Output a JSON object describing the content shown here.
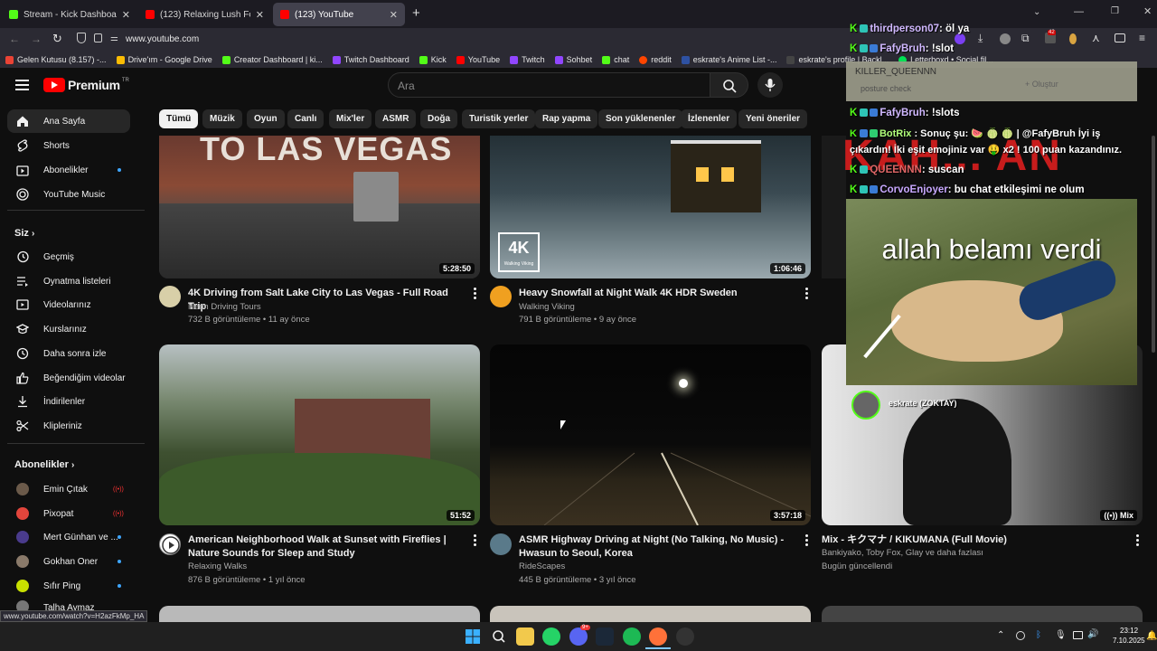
{
  "browser": {
    "tabs": [
      {
        "title": "Stream - Kick Dashboard",
        "color": "#53fc18"
      },
      {
        "title": "(123) Relaxing Lush Forest Thun",
        "color": "#ff0000"
      },
      {
        "title": "(123) YouTube",
        "color": "#ff0000"
      }
    ],
    "url": "www.youtube.com",
    "new_tab": "+",
    "ext_badge": "42",
    "bookmarks": [
      {
        "label": "Gelen Kutusu (8.157) -...",
        "color": "#ea4335"
      },
      {
        "label": "Drive'ım - Google Drive",
        "color": "#fbbc04"
      },
      {
        "label": "Creator Dashboard | ki...",
        "color": "#53fc18"
      },
      {
        "label": "Twitch Dashboard",
        "color": "#9146ff"
      },
      {
        "label": "Kick",
        "color": "#53fc18"
      },
      {
        "label": "YouTube",
        "color": "#ff0000"
      },
      {
        "label": "Twitch",
        "color": "#9146ff"
      },
      {
        "label": "Sohbet",
        "color": "#9146ff"
      },
      {
        "label": "chat",
        "color": "#53fc18"
      },
      {
        "label": "reddit",
        "color": "#ff4500"
      },
      {
        "label": "eskrate's Anime List -...",
        "color": "#2e51a2"
      },
      {
        "label": "eskrate's profile | Backl...",
        "color": "#444444"
      },
      {
        "label": "Letterboxd • Social fil...",
        "color": "#00e054"
      }
    ],
    "status_url": "www.youtube.com/watch?v=H2azFkMp_HA"
  },
  "youtube": {
    "brand": "Premium",
    "region": "TR",
    "search_placeholder": "Ara",
    "chips": [
      "Tümü",
      "Müzik",
      "Oyun",
      "Canlı",
      "Mix'ler",
      "ASMR",
      "Doğa",
      "Turistik yerler",
      "Rap yapma",
      "Son yüklenenler",
      "İzlenenler",
      "Yeni öneriler"
    ],
    "sidebar": {
      "main": [
        "Ana Sayfa",
        "Shorts",
        "Abonelikler",
        "YouTube Music"
      ],
      "you_header": "Siz",
      "you": [
        "Geçmiş",
        "Oynatma listeleri",
        "Videolarınız",
        "Kurslarınız",
        "Daha sonra izle",
        "Beğendiğim videolar",
        "İndirilenler",
        "Klipleriniz"
      ],
      "subs_header": "Abonelikler",
      "subs": [
        "Emin Çıtak",
        "Pixopat",
        "Mert Günhan ve ...",
        "Gokhan Oner",
        "Sıfır Ping",
        "Talha Aymaz"
      ]
    },
    "videos": [
      {
        "title": "4K Driving from Salt Lake City to Las Vegas - Full Road Trip",
        "channel": "Neon Driving Tours",
        "meta": "732 B görüntüleme • 11 ay önce",
        "duration": "5:28:50",
        "overlay": "TO LAS VEGAS"
      },
      {
        "title": "Heavy Snowfall at Night Walk 4K HDR Sweden",
        "channel": "Walking Viking",
        "meta": "791 B görüntüleme • 9 ay önce",
        "duration": "1:06:46",
        "overlay": "4K",
        "overlay_sub": "Walking Viking"
      },
      {
        "title": "American Neighborhood Walk at Sunset with Fireflies | Nature Sounds for Sleep and Study",
        "channel": "Relaxing Walks",
        "meta": "876 B görüntüleme • 1 yıl önce",
        "duration": "51:52"
      },
      {
        "title": "ASMR Highway Driving at Night (No Talking, No Music) - Hwasun to Seoul, Korea",
        "channel": "RideScapes",
        "meta": "445 B görüntüleme • 3 yıl önce",
        "duration": "3:57:18"
      },
      {
        "title": "Mix - キクマナ / KIKUMANA (Full Movie)",
        "channel": "Bankiyako, Toby Fox, Glay ve daha fazlası",
        "meta": "Bugün güncellendi",
        "duration": "Mix"
      }
    ]
  },
  "stream_overlay": {
    "chat": [
      {
        "user": "thirdperson07",
        "text": ": öl ya"
      },
      {
        "user": "FafyBruh",
        "text": ": !slot"
      },
      {
        "user": "FafyBruh",
        "text": ": !slots"
      },
      {
        "user": "BotRix",
        "text": ": Sonuç şu: 🍉 🍈 🍈 | @FafyBruh İyi iş çıkardın! İki eşit emojiniz var 😊 x2 ! 100 puan kazandınız."
      },
      {
        "user": "QUEENNN",
        "text": ": suscan"
      },
      {
        "user": "CorvoEnjoyer",
        "text": ": bu chat etkileşimi ne olum"
      }
    ],
    "botrix_line2": "çıkardın! İki eşit emojiniz var 🤑 x2 ! 100 puan kazandınız.",
    "community_user": "KILLER_QUEENNN",
    "community_text": "posture check",
    "create_label": "+ Oluştur",
    "meme_caption": "allah belamı verdi",
    "cam_label": "eskrate (ZOKTAY)",
    "alert_text": "KAH... AN"
  },
  "taskbar": {
    "time": "23:12",
    "date": "7.10.2025",
    "discord_badge": "9+"
  }
}
